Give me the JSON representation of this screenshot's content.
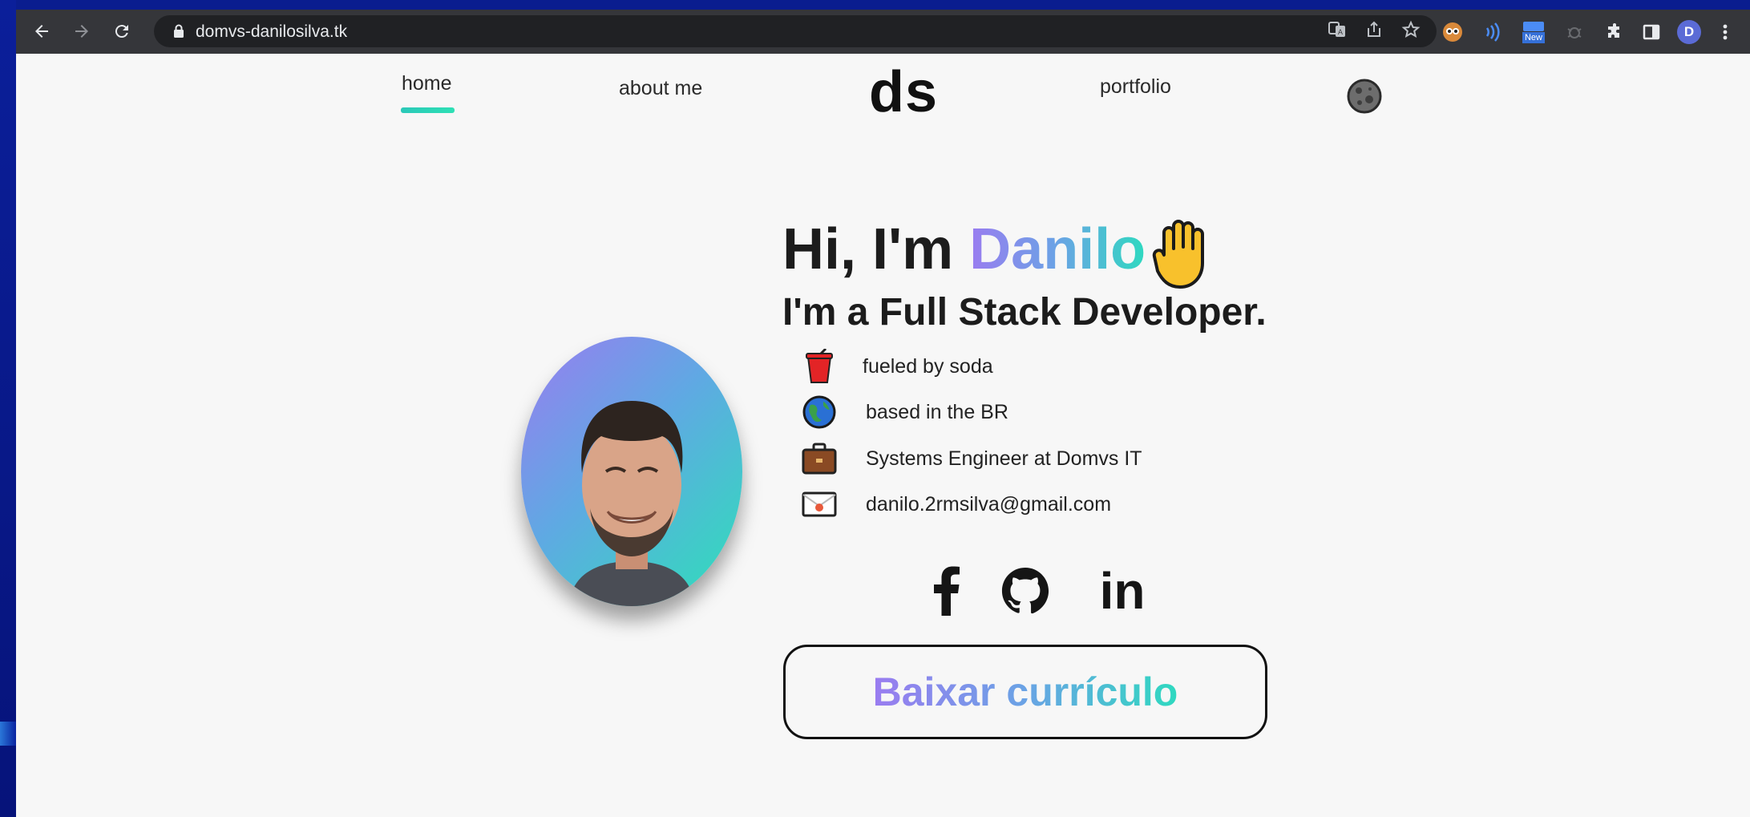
{
  "browser": {
    "url": "domvs-danilosilva.tk",
    "profile_initial": "D",
    "icons": [
      "back-arrow-icon",
      "forward-arrow-icon",
      "reload-icon",
      "lock-icon",
      "translate-icon",
      "share-icon",
      "star-icon",
      "extension-icon",
      "puzzle-icon",
      "side-panel-icon",
      "kebab-menu-icon"
    ],
    "new_badge": "New"
  },
  "nav": {
    "home": "home",
    "about": "about me",
    "logo": "ds",
    "portfolio": "portfolio"
  },
  "hero": {
    "greeting": "Hi, I'm ",
    "name": "Danilo",
    "subtitle": "I'm a Full Stack Developer."
  },
  "info": [
    {
      "icon": "soda-cup-icon",
      "text": "fueled by soda"
    },
    {
      "icon": "globe-icon",
      "text": "based in the BR"
    },
    {
      "icon": "briefcase-icon",
      "text": "Systems Engineer at Domvs IT"
    },
    {
      "icon": "envelope-icon",
      "text": "danilo.2rmsilva@gmail.com"
    }
  ],
  "social": [
    "facebook-icon",
    "github-icon",
    "linkedin-icon"
  ],
  "social_text": {
    "linkedin": "in",
    "facebook": "f"
  },
  "cv_button": {
    "part1": "Baixar ",
    "part2": "currículo"
  },
  "colors": {
    "accent_purple": "#9a7cf0",
    "accent_teal": "#2fd9c0",
    "toolbar": "#35363a",
    "page_bg": "#f7f7f7"
  }
}
